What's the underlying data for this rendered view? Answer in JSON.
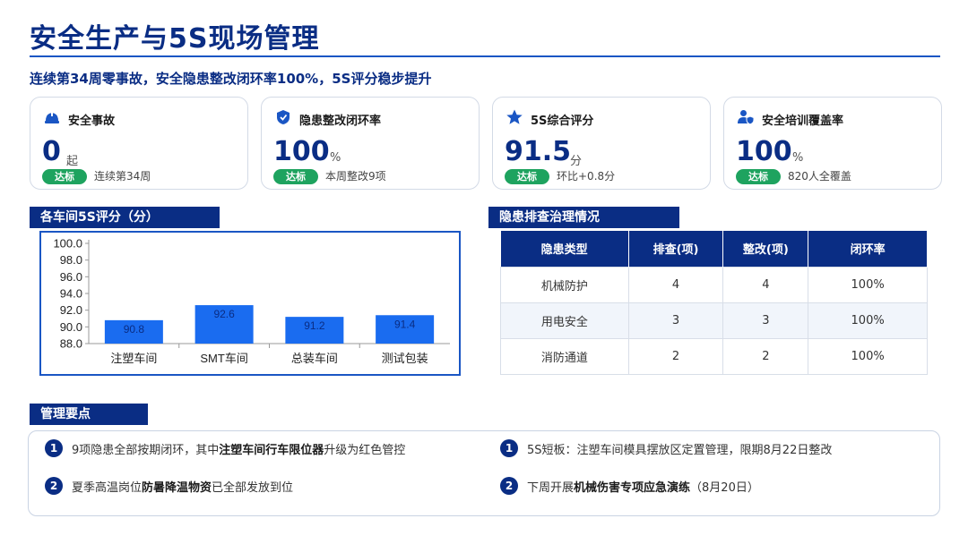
{
  "header": {
    "title": "安全生产与5S现场管理",
    "subtitle": "连续第34周零事故，安全隐患整改闭环率100%，5S评分稳步提升"
  },
  "kpis": [
    {
      "label": "安全事故",
      "value": "0",
      "unit": "起",
      "badge": "达标",
      "note": "连续第34周",
      "icon": "helmet-icon"
    },
    {
      "label": "隐患整改闭环率",
      "value": "100",
      "unit": "%",
      "badge": "达标",
      "note": "本周整改9项",
      "icon": "shield-icon"
    },
    {
      "label": "5S综合评分",
      "value": "91.5",
      "unit": "分",
      "badge": "达标",
      "note": "环比+0.8分",
      "icon": "star-icon"
    },
    {
      "label": "安全培训覆盖率",
      "value": "100",
      "unit": "%",
      "badge": "达标",
      "note": "820人全覆盖",
      "icon": "user-shield-icon"
    }
  ],
  "chart_section": {
    "title": "各车间5S评分（分）"
  },
  "chart_data": {
    "type": "bar",
    "categories": [
      "注塑车间",
      "SMT车间",
      "总装车间",
      "测试包装"
    ],
    "values": [
      90.8,
      92.6,
      91.2,
      91.4
    ],
    "ylim": [
      88.0,
      100.0
    ],
    "yticks": [
      "100.0",
      "98.0",
      "96.0",
      "94.0",
      "92.0",
      "90.0",
      "88.0"
    ],
    "bar_color": "#1a6cf0",
    "grid": false
  },
  "table_section": {
    "title": "隐患排查治理情况",
    "headers": [
      "隐患类型",
      "排查(项)",
      "整改(项)",
      "闭环率"
    ],
    "rows": [
      [
        "机械防护",
        "4",
        "4",
        "100%"
      ],
      [
        "用电安全",
        "3",
        "3",
        "100%"
      ],
      [
        "消防通道",
        "2",
        "2",
        "100%"
      ]
    ]
  },
  "notes_section": {
    "title": "管理要点",
    "items": [
      {
        "num": "1",
        "pre": "9项隐患全部按期闭环，其中",
        "bold": "注塑车间行车限位器",
        "post": "升级为红色管控"
      },
      {
        "num": "2",
        "pre": "夏季高温岗位",
        "bold": "防暑降温物资",
        "post": "已全部发放到位"
      },
      {
        "num": "1",
        "pre": "5S短板：注塑车间模具摆放区定置管理，限期8月22日整改",
        "bold": "",
        "post": ""
      },
      {
        "num": "2",
        "pre": "下周开展",
        "bold": "机械伤害专项应急演练",
        "post": "（8月20日）"
      }
    ]
  },
  "colors": {
    "primary": "#0a2d84",
    "accent": "#1a6cf0",
    "ok": "#1ea35f"
  }
}
